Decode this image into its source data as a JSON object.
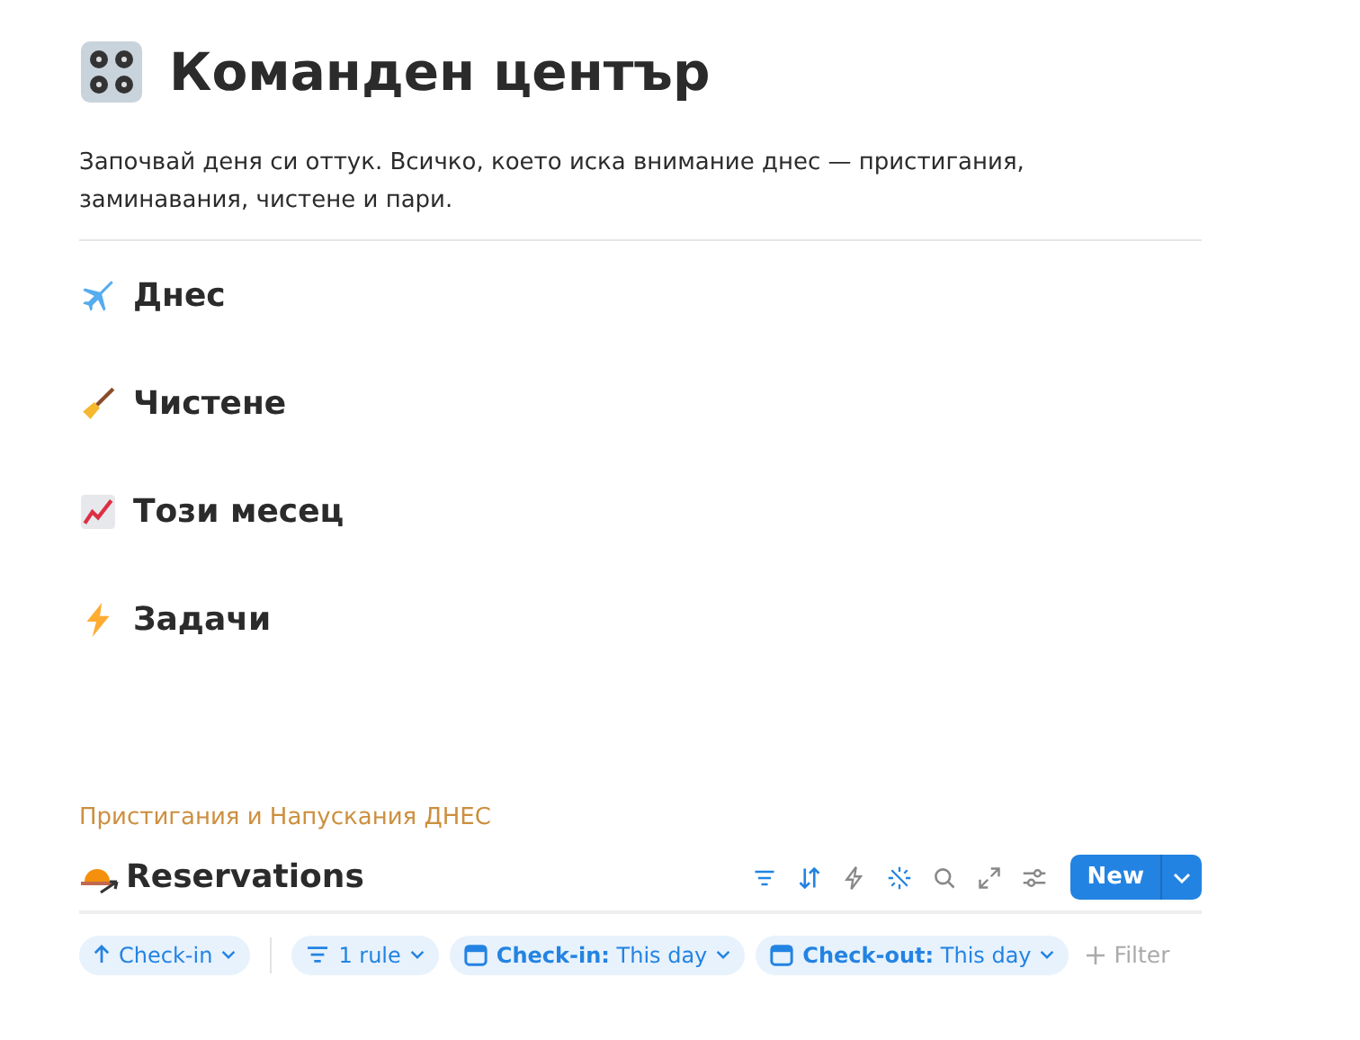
{
  "page": {
    "title": "Команден център",
    "description": "Започвай деня си оттук. Всичко, което иска внимание днес — пристигания, заминавания, чистене и пари."
  },
  "sections": [
    {
      "kind": "plane",
      "title": "Днес"
    },
    {
      "kind": "broom",
      "title": "Чистене"
    },
    {
      "kind": "chart",
      "title": "Този месец"
    },
    {
      "kind": "bolt",
      "title": "Задачи"
    }
  ],
  "database": {
    "caption": "Пристигания и Напускания ДНЕС",
    "title": "Reservations",
    "new_button": "New",
    "filters": [
      {
        "kind": "sort",
        "label": "Check-in"
      },
      {
        "kind": "rule",
        "label": "1 rule"
      },
      {
        "kind": "date",
        "label": "**Check-in:** This day"
      },
      {
        "kind": "date",
        "label": "**Check-out:** This day"
      }
    ],
    "add_filter": "Filter"
  }
}
